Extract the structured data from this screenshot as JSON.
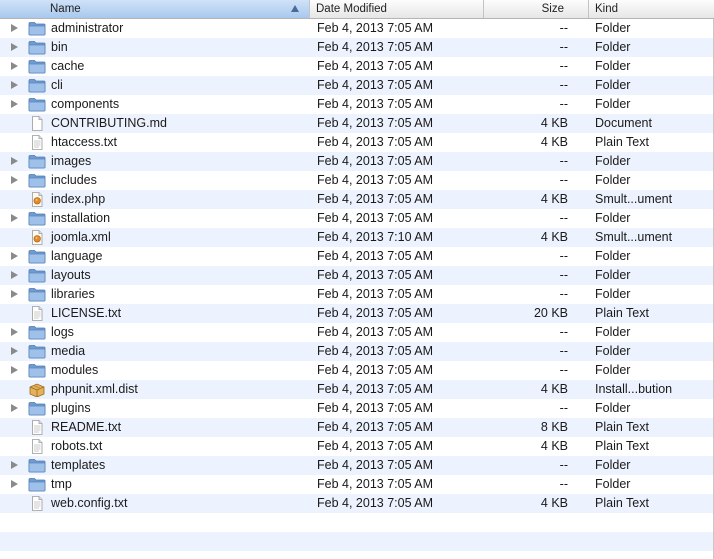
{
  "columns": {
    "name": "Name",
    "date": "Date Modified",
    "size": "Size",
    "kind": "Kind"
  },
  "files": [
    {
      "name": "administrator",
      "date": "Feb 4, 2013 7:05 AM",
      "size": "--",
      "kind": "Folder",
      "icon": "folder-icon",
      "expandable": true
    },
    {
      "name": "bin",
      "date": "Feb 4, 2013 7:05 AM",
      "size": "--",
      "kind": "Folder",
      "icon": "folder-icon",
      "expandable": true
    },
    {
      "name": "cache",
      "date": "Feb 4, 2013 7:05 AM",
      "size": "--",
      "kind": "Folder",
      "icon": "folder-icon",
      "expandable": true
    },
    {
      "name": "cli",
      "date": "Feb 4, 2013 7:05 AM",
      "size": "--",
      "kind": "Folder",
      "icon": "folder-icon",
      "expandable": true
    },
    {
      "name": "components",
      "date": "Feb 4, 2013 7:05 AM",
      "size": "--",
      "kind": "Folder",
      "icon": "folder-icon",
      "expandable": true
    },
    {
      "name": "CONTRIBUTING.md",
      "date": "Feb 4, 2013 7:05 AM",
      "size": "4 KB",
      "kind": "Document",
      "icon": "document-icon",
      "expandable": false
    },
    {
      "name": "htaccess.txt",
      "date": "Feb 4, 2013 7:05 AM",
      "size": "4 KB",
      "kind": "Plain Text",
      "icon": "text-file-icon",
      "expandable": false
    },
    {
      "name": "images",
      "date": "Feb 4, 2013 7:05 AM",
      "size": "--",
      "kind": "Folder",
      "icon": "folder-icon",
      "expandable": true
    },
    {
      "name": "includes",
      "date": "Feb 4, 2013 7:05 AM",
      "size": "--",
      "kind": "Folder",
      "icon": "folder-icon",
      "expandable": true
    },
    {
      "name": "index.php",
      "date": "Feb 4, 2013 7:05 AM",
      "size": "4 KB",
      "kind": "Smult...ument",
      "icon": "smultron-document-icon",
      "expandable": false
    },
    {
      "name": "installation",
      "date": "Feb 4, 2013 7:05 AM",
      "size": "--",
      "kind": "Folder",
      "icon": "folder-icon",
      "expandable": true
    },
    {
      "name": "joomla.xml",
      "date": "Feb 4, 2013 7:10 AM",
      "size": "4 KB",
      "kind": "Smult...ument",
      "icon": "smultron-document-icon",
      "expandable": false
    },
    {
      "name": "language",
      "date": "Feb 4, 2013 7:05 AM",
      "size": "--",
      "kind": "Folder",
      "icon": "folder-icon",
      "expandable": true
    },
    {
      "name": "layouts",
      "date": "Feb 4, 2013 7:05 AM",
      "size": "--",
      "kind": "Folder",
      "icon": "folder-icon",
      "expandable": true
    },
    {
      "name": "libraries",
      "date": "Feb 4, 2013 7:05 AM",
      "size": "--",
      "kind": "Folder",
      "icon": "folder-icon",
      "expandable": true
    },
    {
      "name": "LICENSE.txt",
      "date": "Feb 4, 2013 7:05 AM",
      "size": "20 KB",
      "kind": "Plain Text",
      "icon": "text-file-icon",
      "expandable": false
    },
    {
      "name": "logs",
      "date": "Feb 4, 2013 7:05 AM",
      "size": "--",
      "kind": "Folder",
      "icon": "folder-icon",
      "expandable": true
    },
    {
      "name": "media",
      "date": "Feb 4, 2013 7:05 AM",
      "size": "--",
      "kind": "Folder",
      "icon": "folder-icon",
      "expandable": true
    },
    {
      "name": "modules",
      "date": "Feb 4, 2013 7:05 AM",
      "size": "--",
      "kind": "Folder",
      "icon": "folder-icon",
      "expandable": true
    },
    {
      "name": "phpunit.xml.dist",
      "date": "Feb 4, 2013 7:05 AM",
      "size": "4 KB",
      "kind": "Install...bution",
      "icon": "installer-package-icon",
      "expandable": false
    },
    {
      "name": "plugins",
      "date": "Feb 4, 2013 7:05 AM",
      "size": "--",
      "kind": "Folder",
      "icon": "folder-icon",
      "expandable": true
    },
    {
      "name": "README.txt",
      "date": "Feb 4, 2013 7:05 AM",
      "size": "8 KB",
      "kind": "Plain Text",
      "icon": "text-file-icon",
      "expandable": false
    },
    {
      "name": "robots.txt",
      "date": "Feb 4, 2013 7:05 AM",
      "size": "4 KB",
      "kind": "Plain Text",
      "icon": "text-file-icon",
      "expandable": false
    },
    {
      "name": "templates",
      "date": "Feb 4, 2013 7:05 AM",
      "size": "--",
      "kind": "Folder",
      "icon": "folder-icon",
      "expandable": true
    },
    {
      "name": "tmp",
      "date": "Feb 4, 2013 7:05 AM",
      "size": "--",
      "kind": "Folder",
      "icon": "folder-icon",
      "expandable": true
    },
    {
      "name": "web.config.txt",
      "date": "Feb 4, 2013 7:05 AM",
      "size": "4 KB",
      "kind": "Plain Text",
      "icon": "text-file-icon",
      "expandable": false
    }
  ],
  "colors": {
    "row_alt": "#edf3fe",
    "header_sorted": "#b9d3f3",
    "folder_blue": "#7fa8d8"
  }
}
